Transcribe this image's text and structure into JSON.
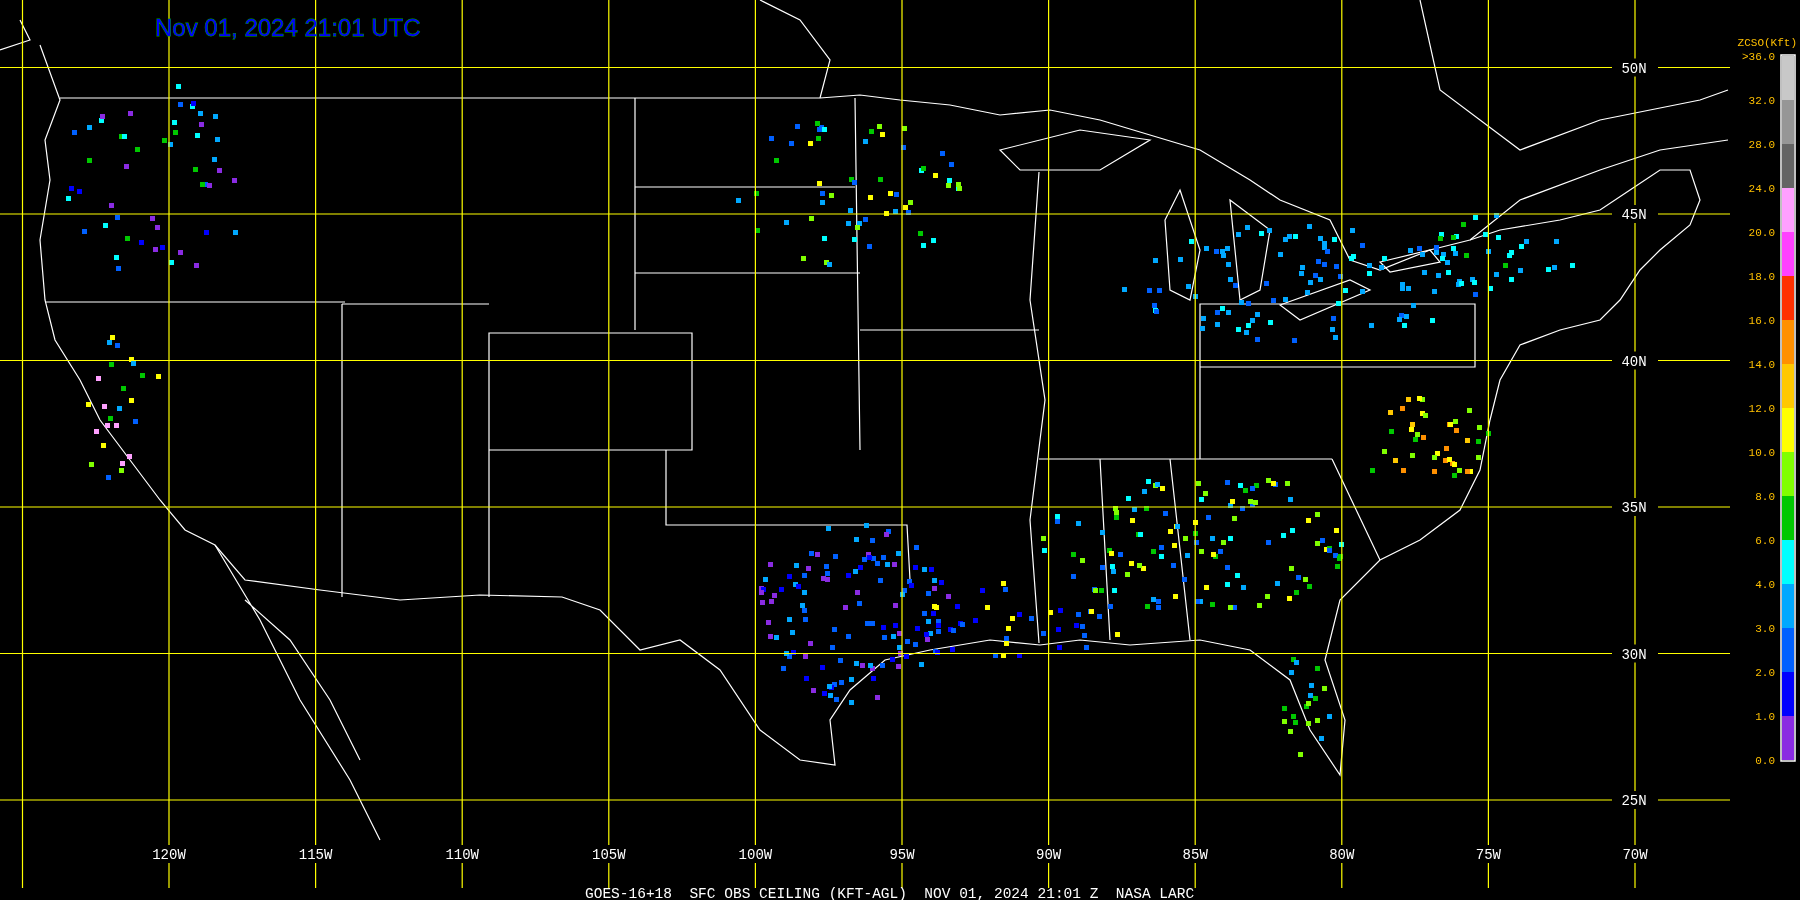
{
  "title": "Nov 01, 2024 21:01 UTC",
  "longitudes": [
    "120W",
    "115W",
    "110W",
    "105W",
    "100W",
    "95W",
    "90W",
    "85W",
    "80W",
    "75W",
    "70W"
  ],
  "latitudes": [
    "50N",
    "45N",
    "40N",
    "35N",
    "30N",
    "25N"
  ],
  "legend": {
    "title": "ZCSO(Kft)",
    "labels": [
      ">36.0",
      "32.0",
      "28.0",
      "24.0",
      "20.0",
      "18.0",
      "16.0",
      "14.0",
      "12.0",
      "10.0",
      "8.0",
      "6.0",
      "4.0",
      "3.0",
      "2.0",
      "1.0",
      "0.0"
    ],
    "segments": [
      {
        "color": "#c8c8c8"
      },
      {
        "color": "#969696"
      },
      {
        "color": "#646464"
      },
      {
        "color": "#ffa0ff"
      },
      {
        "color": "#ff40ff"
      },
      {
        "color": "#ff3000"
      },
      {
        "color": "#ff9000"
      },
      {
        "color": "#ffc800"
      },
      {
        "color": "#ffff00"
      },
      {
        "color": "#80ff00"
      },
      {
        "color": "#00c800"
      },
      {
        "color": "#00ffff"
      },
      {
        "color": "#00a8ff"
      },
      {
        "color": "#0060ff"
      },
      {
        "color": "#0000ff"
      },
      {
        "color": "#8a2be2"
      }
    ]
  },
  "caption": "GOES-16+18  SFC OBS CEILING (KFT-AGL)  NOV 01, 2024 21:01 Z  NASA LARC"
}
